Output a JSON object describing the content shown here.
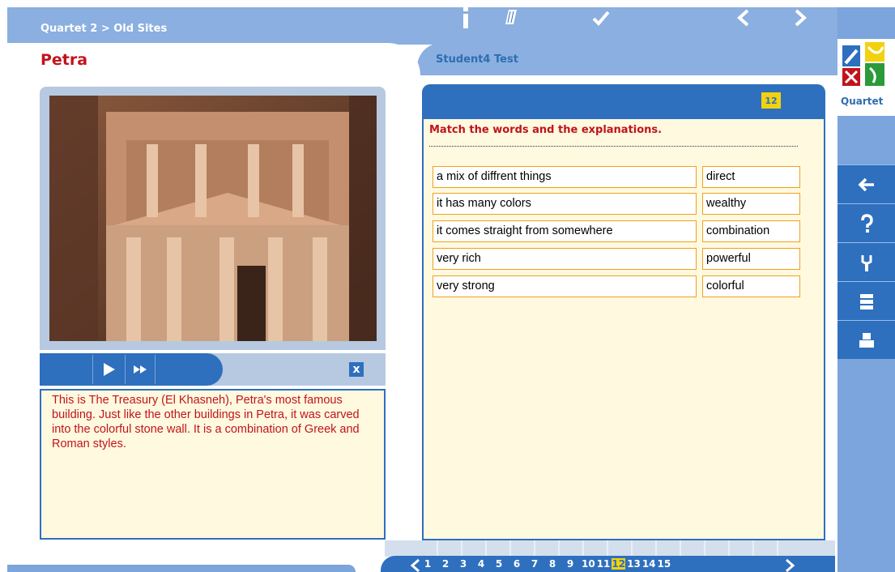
{
  "header": {
    "breadcrumb": "Quartet 2 > Old Sites",
    "page_title": "Petra",
    "student": "Student4 Test"
  },
  "logo": {
    "text": "Quartet"
  },
  "right_rail": {
    "buttons": [
      "back-arrow-icon",
      "help-icon",
      "tools-icon",
      "list-icon",
      "print-icon"
    ]
  },
  "media": {
    "caption": "This is The Treasury (El Khasneh), Petra's most famous building. Just like the other buildings in Petra, it was carved into the colorful stone wall. It is a combination of Greek and Roman styles.",
    "close_label": "x"
  },
  "exercise": {
    "page_number": "12",
    "instruction": "Match the words and the explanations.",
    "rows": [
      {
        "left": "a mix of diffrent things",
        "right": "direct"
      },
      {
        "left": "it has many colors",
        "right": "wealthy"
      },
      {
        "left": "it comes straight from somewhere",
        "right": "combination"
      },
      {
        "left": "very rich",
        "right": "powerful"
      },
      {
        "left": "very strong",
        "right": "colorful"
      }
    ]
  },
  "pager": {
    "pages": [
      "1",
      "2",
      "3",
      "4",
      "5",
      "6",
      "7",
      "8",
      "9",
      "10",
      "11",
      "12",
      "13",
      "14",
      "15"
    ],
    "current": "12"
  },
  "colors": {
    "brand_blue": "#2e6fbe",
    "light_blue": "#8aafe0",
    "title_red": "#c0141c",
    "highlight_yellow": "#f2d20f",
    "cell_border": "#f0a020",
    "panel_bg": "#fff9df"
  }
}
